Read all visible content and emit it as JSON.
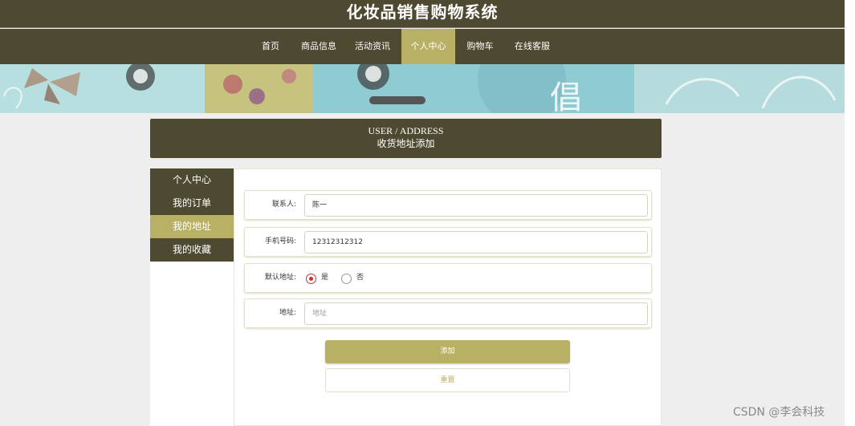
{
  "site": {
    "title": "化妆品销售购物系统"
  },
  "nav": {
    "items": [
      {
        "label": "首页"
      },
      {
        "label": "商品信息"
      },
      {
        "label": "活动资讯"
      },
      {
        "label": "个人中心",
        "active": true
      },
      {
        "label": "购物车"
      },
      {
        "label": "在线客服"
      }
    ]
  },
  "page_header": {
    "english": "USER / ADDRESS",
    "chinese": "收货地址添加"
  },
  "sidebar": {
    "items": [
      {
        "label": "个人中心"
      },
      {
        "label": "我的订单"
      },
      {
        "label": "我的地址",
        "active": true
      },
      {
        "label": "我的收藏"
      }
    ]
  },
  "form": {
    "contact": {
      "label": "联系人:",
      "value": "陈一"
    },
    "phone": {
      "label": "手机号码:",
      "value": "12312312312"
    },
    "default_address": {
      "label": "默认地址:",
      "options": [
        "是",
        "否"
      ],
      "selected": "是"
    },
    "address": {
      "label": "地址:",
      "placeholder": "地址"
    },
    "submit_label": "添加",
    "reset_label": "重置"
  },
  "watermark": "CSDN @李会科技",
  "colors": {
    "primary": "#4e4a31",
    "accent": "#b8b065",
    "radio": "#c9302c"
  }
}
